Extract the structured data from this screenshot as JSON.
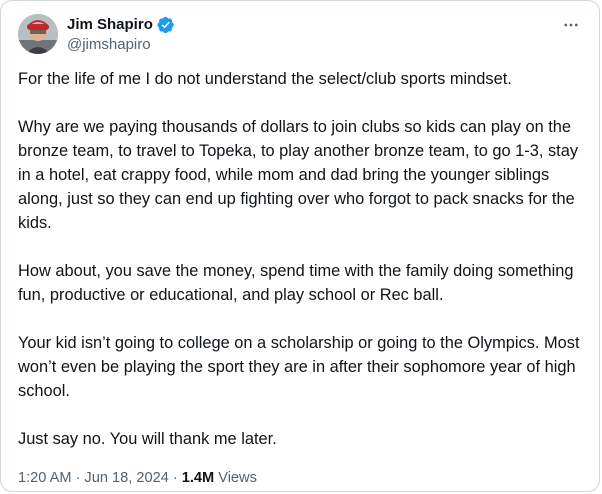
{
  "author": {
    "display_name": "Jim Shapiro",
    "handle": "@jimshapiro",
    "verified": true,
    "verified_color": "#1d9bf0"
  },
  "menu_icon": "more-horizontal-icon",
  "tweet": {
    "paragraphs": [
      "For the life of me I do not understand the select/club sports mindset.",
      "Why are we paying thousands of dollars to join clubs so kids can play on the bronze team, to travel to Topeka, to play another bronze team, to go 1-3, stay in a hotel, eat crappy food, while mom and dad bring the younger siblings along, just so they can end up fighting over who forgot to pack snacks for the kids.",
      "How about, you save the money, spend time with the family doing something fun, productive or educational, and play school or Rec ball.",
      "Your kid isn’t going to college on a scholarship or going to the Olympics. Most won’t even be playing the sport they are in after their sophomore year of high school.",
      "Just say no. You will thank me later."
    ]
  },
  "meta": {
    "time": "1:20 AM",
    "separator": "·",
    "date": "Jun 18, 2024",
    "views_count": "1.4M",
    "views_label": "Views"
  }
}
